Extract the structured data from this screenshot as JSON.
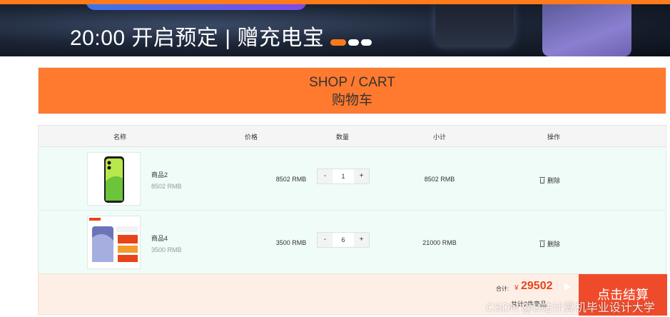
{
  "banner": {
    "text": "20:00 开启预定 | 赠充电宝"
  },
  "cart_header": {
    "title_en": "SHOP / CART",
    "title_cn": "购物车"
  },
  "table": {
    "columns": [
      "名称",
      "价格",
      "数量",
      "小计",
      "操作"
    ],
    "rows": [
      {
        "name": "商品2",
        "price_note": "8502 RMB",
        "unit_price": "8502 RMB",
        "quantity": "1",
        "subtotal": "8502 RMB",
        "delete_label": "删除",
        "decrement": "-",
        "increment": "+"
      },
      {
        "name": "商品4",
        "price_note": "3500 RMB",
        "unit_price": "3500 RMB",
        "quantity": "6",
        "subtotal": "21000 RMB",
        "delete_label": "删除",
        "decrement": "-",
        "increment": "+"
      }
    ]
  },
  "footer": {
    "total_label": "合计:",
    "currency_symbol": "¥",
    "total_value": "29502",
    "count_note": "共计2件商品",
    "checkout_label": "点击结算"
  },
  "watermark": "CSDN @B站计算机毕业设计大学",
  "colors": {
    "accent": "#ff7a2e",
    "checkout": "#ef4b2b",
    "row_bg": "#effcf7",
    "footer_bg": "#fdefe6",
    "price_red": "#e8431a"
  },
  "icons": [
    "trash-icon"
  ]
}
